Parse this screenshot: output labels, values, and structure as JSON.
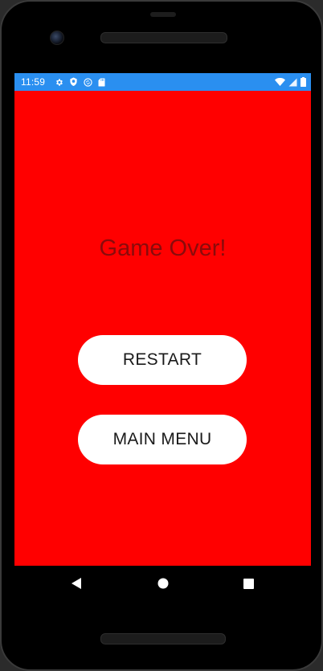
{
  "status_bar": {
    "time": "11:59",
    "background": "#2a8ff0",
    "left_icons": [
      "gear-icon",
      "shield-icon",
      "sync-icon",
      "sd-card-icon"
    ],
    "right_icons": [
      "wifi-icon",
      "cellular-signal-icon",
      "battery-icon"
    ]
  },
  "game_over": {
    "title": "Game Over!",
    "background": "#ff0000",
    "title_color": "#8a0b0b",
    "restart_label": "RESTART",
    "main_menu_label": "MAIN MENU"
  },
  "nav_bar": {
    "buttons": [
      "back-icon",
      "home-icon",
      "recents-icon"
    ]
  }
}
